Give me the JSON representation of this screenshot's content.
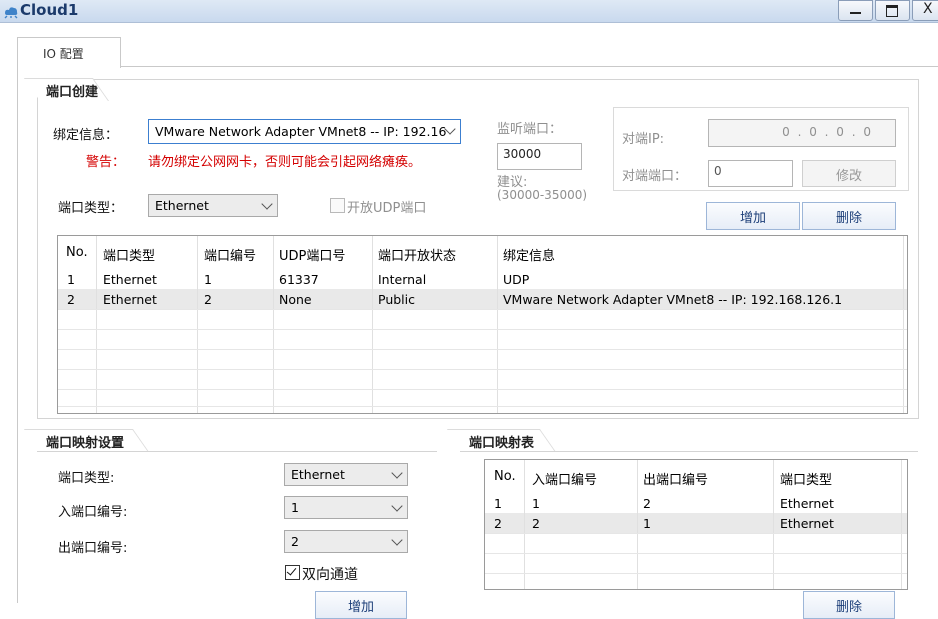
{
  "window": {
    "title": "Cloud1"
  },
  "tab": {
    "label": "IO 配置"
  },
  "port_create": {
    "title": "端口创建",
    "binding_label": "绑定信息：",
    "binding_value": "VMware Network Adapter VMnet8 -- IP: 192.16",
    "warning_label": "警告：",
    "warning_text": "请勿绑定公网网卡，否则可能会引起网络瘫痪。",
    "port_type_label": "端口类型：",
    "port_type_value": "Ethernet",
    "udp_checkbox_label": "开放UDP端口",
    "listen_label": "监听端口：",
    "listen_value": "30000",
    "suggest_label": "建议:",
    "suggest_range": "(30000-35000)",
    "peer_ip_label": "对端IP:",
    "peer_ip_value": "0 . 0 . 0 . 0",
    "peer_port_label": "对端端口：",
    "peer_port_value": "0",
    "modify_button": "修改",
    "add_button": "增加",
    "delete_button": "删除",
    "table": {
      "columns": [
        "No.",
        "端口类型",
        "端口编号",
        "UDP端口号",
        "端口开放状态",
        "绑定信息"
      ],
      "rows": [
        [
          "1",
          "Ethernet",
          "1",
          "61337",
          "Internal",
          "UDP"
        ],
        [
          "2",
          "Ethernet",
          "2",
          "None",
          "Public",
          "VMware Network Adapter VMnet8 -- IP: 192.168.126.1"
        ]
      ]
    }
  },
  "port_mapping": {
    "title": "端口映射设置",
    "port_type_label": "端口类型:",
    "port_type_value": "Ethernet",
    "in_port_label": "入端口编号:",
    "in_port_value": "1",
    "out_port_label": "出端口编号:",
    "out_port_value": "2",
    "bidirectional_label": "双向通道",
    "bidirectional_checked": true,
    "add_button": "增加"
  },
  "mapping_table": {
    "title": "端口映射表",
    "columns": [
      "No.",
      "入端口编号",
      "出端口编号",
      "端口类型"
    ],
    "rows": [
      [
        "1",
        "1",
        "2",
        "Ethernet"
      ],
      [
        "2",
        "2",
        "1",
        "Ethernet"
      ]
    ],
    "delete_button": "删除"
  }
}
